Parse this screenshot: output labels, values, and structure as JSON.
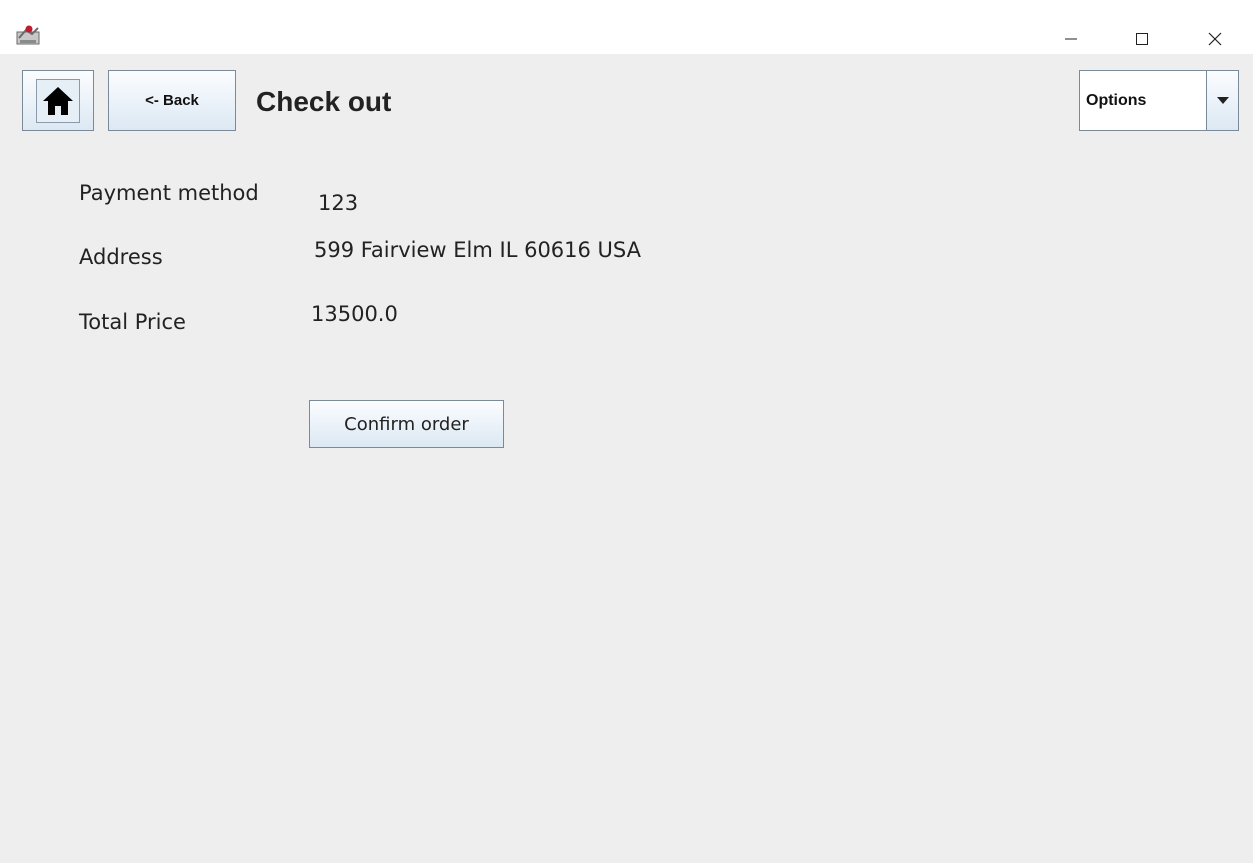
{
  "window": {
    "minimize_glyph": "─",
    "maximize_glyph": "☐",
    "close_glyph": "✕"
  },
  "header": {
    "home_icon": "home-icon",
    "back_label": "<- Back",
    "title": "Check out",
    "options": {
      "selected": "Options"
    }
  },
  "checkout": {
    "payment_label": "Payment method",
    "payment_value": "123",
    "address_label": "Address",
    "address_value": "599 Fairview Elm IL 60616 USA",
    "total_label": "Total Price",
    "total_value": "13500.0",
    "confirm_label": "Confirm order"
  },
  "colors": {
    "background": "#eeeeee",
    "button_gradient_top": "#fbfdff",
    "button_gradient_bottom": "#dce8f3",
    "border": "#7a8a99"
  }
}
